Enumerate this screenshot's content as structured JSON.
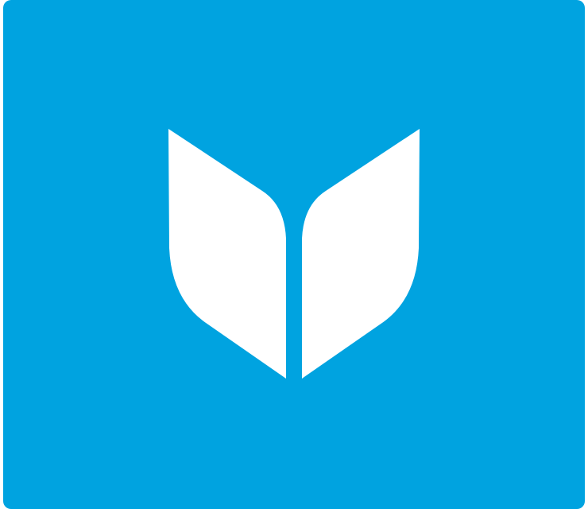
{
  "icon": {
    "name": "open-book-logo",
    "background_color": "#00A3E0",
    "glyph_color": "#FFFFFF"
  }
}
